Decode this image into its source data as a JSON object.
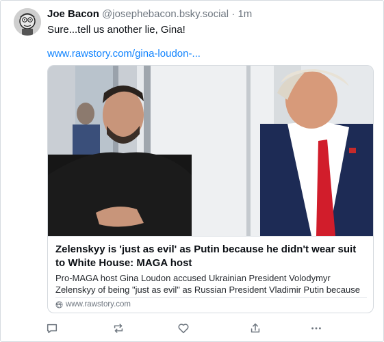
{
  "post": {
    "display_name": "Joe Bacon",
    "handle": "@josephebacon.bsky.social",
    "separator": "·",
    "time": "1m",
    "text": "Sure...tell us another lie, Gina!",
    "link_text": "www.rawstory.com/gina-loudon-..."
  },
  "card": {
    "title": "Zelenskyy is 'just as evil' as Putin because he didn't wear suit to White House: MAGA host",
    "description": "Pro-MAGA host Gina Loudon accused Ukrainian President Volodymyr Zelenskyy of being \"just as evil\" as Russian President Vladimir Putin because ..",
    "domain": "www.rawstory.com"
  },
  "actions": {
    "reply_icon": "speech-bubble-icon",
    "repost_icon": "repost-arrows-icon",
    "like_icon": "heart-icon",
    "share_icon": "share-upload-icon",
    "more_icon": "ellipsis-icon"
  },
  "colors": {
    "link": "#1083fe",
    "muted": "#6f7780",
    "text": "#0b0f14",
    "icon": "#6f7780"
  }
}
